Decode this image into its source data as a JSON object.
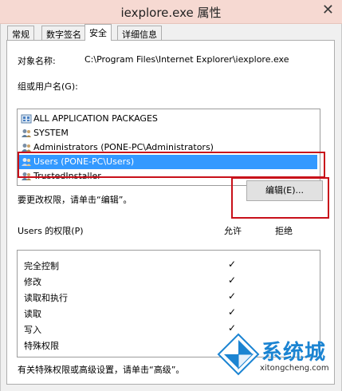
{
  "window": {
    "title": "iexplore.exe 属性",
    "close_glyph": "✕"
  },
  "tabs": [
    {
      "label": "常规",
      "active": false
    },
    {
      "label": "数字签名",
      "active": false
    },
    {
      "label": "安全",
      "active": true
    },
    {
      "label": "详细信息",
      "active": false
    }
  ],
  "object": {
    "label": "对象名称:",
    "value": "C:\\Program Files\\Internet Explorer\\iexplore.exe"
  },
  "groups": {
    "label": "组或用户名(G):",
    "items": [
      {
        "name": "ALL APPLICATION PACKAGES",
        "icon": "packages-icon",
        "selected": false
      },
      {
        "name": "SYSTEM",
        "icon": "users-icon",
        "selected": false
      },
      {
        "name": "Administrators (PONE-PC\\Administrators)",
        "icon": "users-icon",
        "selected": false
      },
      {
        "name": "Users (PONE-PC\\Users)",
        "icon": "users-icon",
        "selected": true
      },
      {
        "name": "TrustedInstaller",
        "icon": "users-icon",
        "selected": false
      }
    ]
  },
  "change_hint": "要更改权限，请单击“编辑”。",
  "edit_button": "编辑(E)...",
  "permissions": {
    "label": "Users 的权限(P)",
    "allow_header": "允许",
    "deny_header": "拒绝",
    "check_glyph": "✓",
    "rows": [
      {
        "name": "完全控制",
        "allow": true
      },
      {
        "name": "修改",
        "allow": true
      },
      {
        "name": "读取和执行",
        "allow": true
      },
      {
        "name": "读取",
        "allow": true
      },
      {
        "name": "写入",
        "allow": true
      },
      {
        "name": "特殊权限",
        "allow": false
      }
    ]
  },
  "advanced_hint": "有关特殊权限或高级设置，请单击“高级”。",
  "watermark": {
    "text": "系统城",
    "sub": "xitongcheng.com"
  },
  "colors": {
    "selection": "#3399ff",
    "highlight_box": "#c8101a",
    "watermark_blue": "#1b84d2",
    "titlebar": "#f6d9d2"
  }
}
